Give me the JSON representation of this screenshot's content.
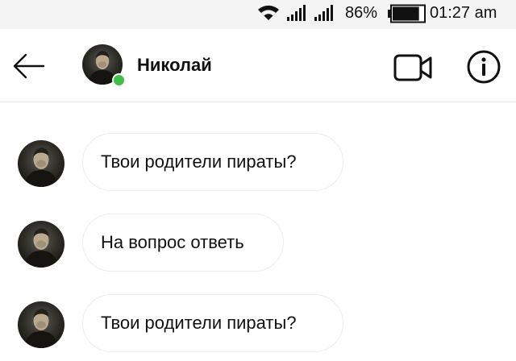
{
  "status_bar": {
    "battery_percent": "86%",
    "time": "01:27 am",
    "battery_level": 0.86,
    "icons": [
      "wifi-icon",
      "signal-icon",
      "signal-icon",
      "battery-icon"
    ]
  },
  "header": {
    "contact_name": "Николай",
    "online": true,
    "online_color": "#3fbf4a",
    "icons": [
      "back-arrow-icon",
      "video-camera-icon",
      "info-icon"
    ]
  },
  "messages": [
    {
      "text": "Твои родители пираты?"
    },
    {
      "text": "На вопрос ответь"
    },
    {
      "text": "Твои родители пираты?"
    }
  ]
}
